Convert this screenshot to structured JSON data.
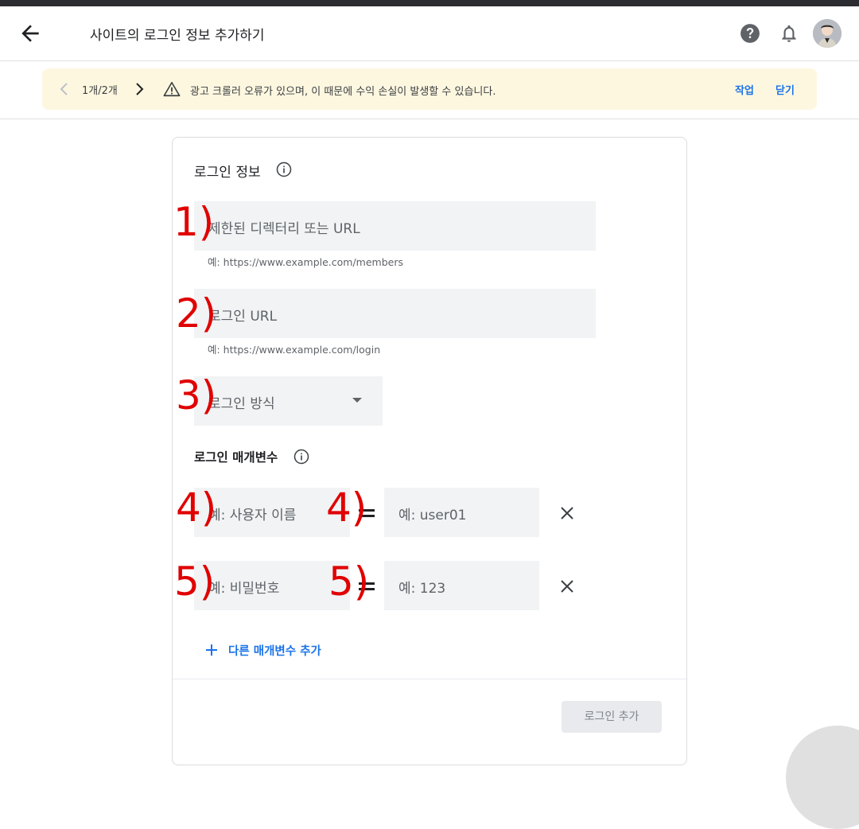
{
  "header": {
    "title": "사이트의 로그인 정보 추가하기"
  },
  "banner": {
    "pager": "1개/2개",
    "message": "광고 크롤러 오류가 있으며, 이 때문에 수익 손실이 발생할 수 있습니다.",
    "action_label": "작업",
    "close_label": "닫기"
  },
  "form": {
    "section_title": "로그인 정보",
    "restricted_url_placeholder": "제한된 디렉터리 또는 URL",
    "restricted_url_helper": "예: https://www.example.com/members",
    "login_url_placeholder": "로그인 URL",
    "login_url_helper": "예: https://www.example.com/login",
    "login_method_placeholder": "로그인 방식",
    "params_title": "로그인 매개변수",
    "params": [
      {
        "name_placeholder": "예: 사용자 이름",
        "value_placeholder": "예: user01"
      },
      {
        "name_placeholder": "예: 비밀번호",
        "value_placeholder": "예: 123"
      }
    ],
    "add_param_label": "다른 매개변수 추가",
    "submit_label": "로그인 추가"
  },
  "annotations": [
    "1)",
    "2)",
    "3)",
    "4)",
    "4)",
    "5)",
    "5)"
  ],
  "colors": {
    "accent": "#1a73e8",
    "banner_bg": "#fef7e0",
    "field_bg": "#f1f3f4",
    "annotation": "#e00000"
  }
}
